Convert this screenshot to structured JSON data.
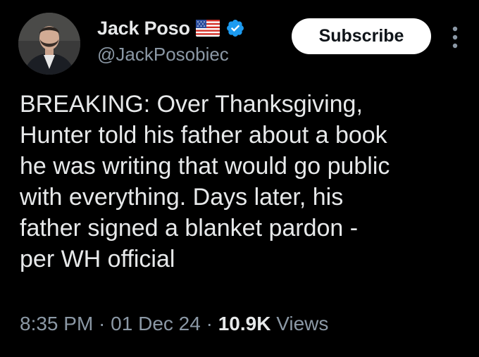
{
  "author": {
    "display_name": "Jack Poso",
    "handle": "@JackPosobiec",
    "avatar_icon": "profile-photo",
    "flag_icon": "us-flag-icon",
    "verified_icon": "verified-badge-icon",
    "verified_color": "#1d9bf0"
  },
  "actions": {
    "subscribe_label": "Subscribe",
    "more_icon": "more-vertical-icon"
  },
  "tweet": {
    "lines": [
      "BREAKING: Over Thanksgiving,",
      "Hunter told his father about a book",
      "he was writing that would go public",
      "with everything. Days later, his",
      "father signed a blanket pardon -",
      "per WH official"
    ]
  },
  "meta": {
    "time": "8:35 PM",
    "separator": " · ",
    "date": "01 Dec 24",
    "views_count": "10.9K",
    "views_label": " Views"
  },
  "colors": {
    "background": "#000000",
    "primary_text": "#e7e9ea",
    "secondary_text": "#8b98a5",
    "button_bg": "#ffffff"
  }
}
